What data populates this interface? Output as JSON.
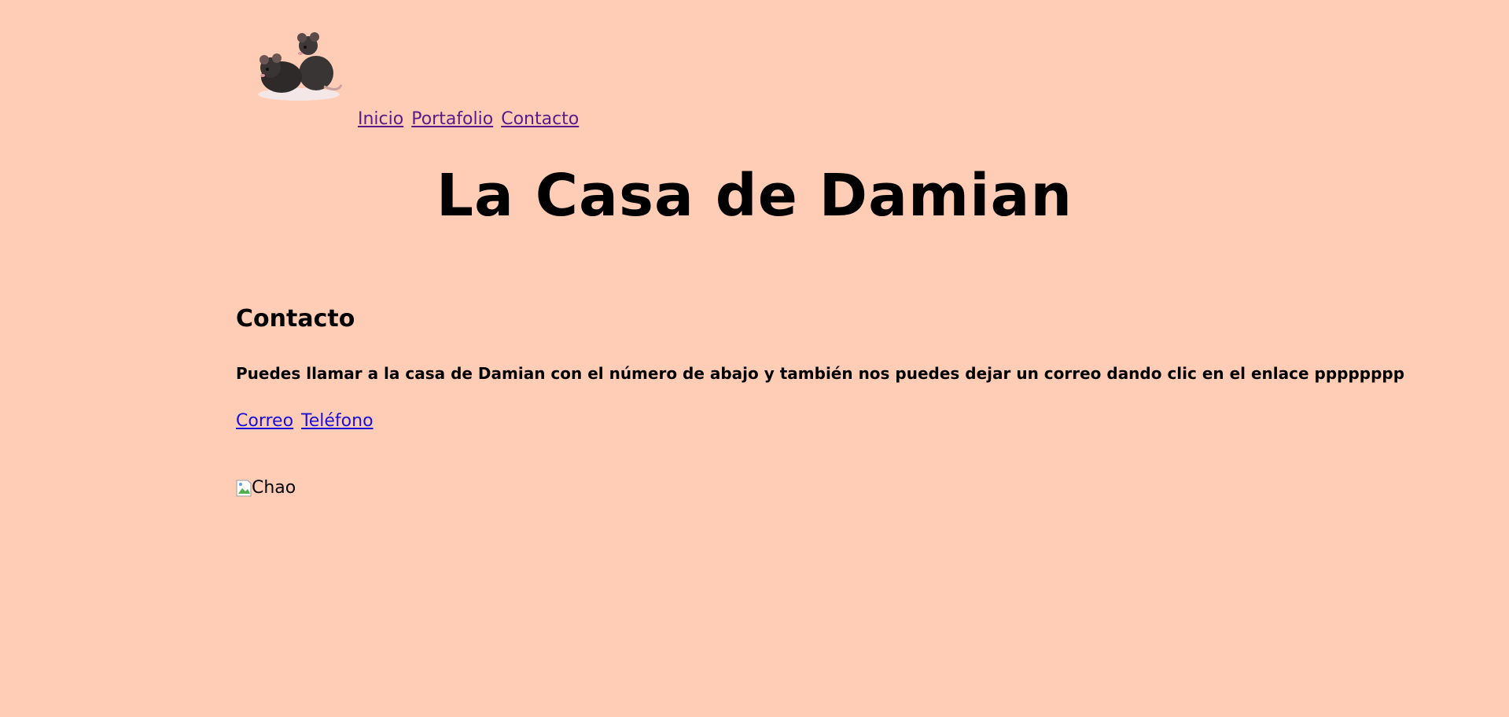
{
  "header": {
    "logo_name": "rats-logo",
    "nav": [
      {
        "label": "Inicio"
      },
      {
        "label": "Portafolio"
      },
      {
        "label": "Contacto"
      }
    ]
  },
  "site_title": "La Casa de Damian",
  "section": {
    "title": "Contacto",
    "description": "Puedes llamar a la casa de Damian con el número de abajo y también nos puedes dejar un correo dando clic en el enlace pppppppp",
    "links": [
      {
        "label": "Correo"
      },
      {
        "label": "Teléfono"
      }
    ]
  },
  "footer_image": {
    "alt": "Chao"
  },
  "colors": {
    "background": "#ffcdb6",
    "nav_link": "#5a1a8a",
    "link": "#1a0ddd"
  }
}
